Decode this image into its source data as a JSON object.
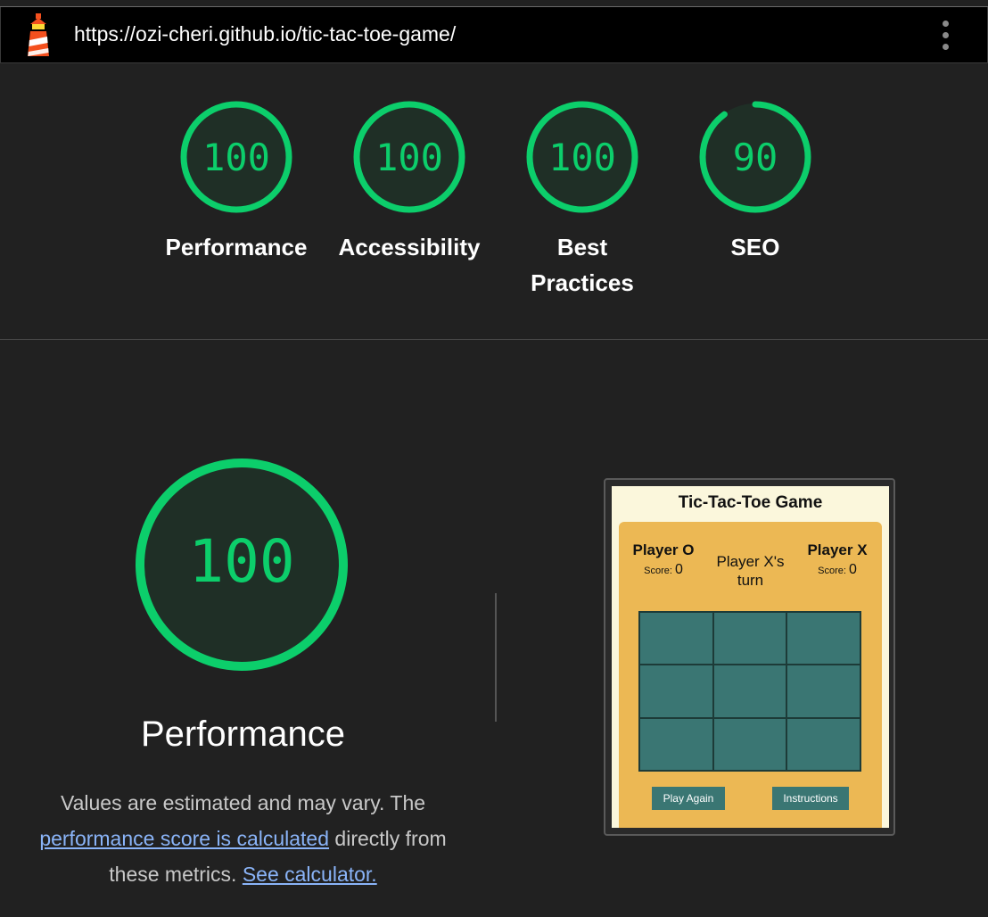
{
  "urlbar": {
    "url": "https://ozi-cheri.github.io/tic-tac-toe-game/"
  },
  "icons": {
    "logo": "lighthouse-icon",
    "menu": "more-vert-icon"
  },
  "colors": {
    "pass": "#0cce6b",
    "gauge_fill": "#1f2f26",
    "link": "#8ab4f8"
  },
  "scores": [
    {
      "value": "100",
      "score": 100,
      "label": "Performance"
    },
    {
      "value": "100",
      "score": 100,
      "label": "Accessibility"
    },
    {
      "value": "100",
      "score": 100,
      "label": "Best Practices"
    },
    {
      "value": "90",
      "score": 90,
      "label": "SEO"
    }
  ],
  "performance": {
    "score": "100",
    "title": "Performance",
    "desc_prefix": "Values are estimated and may vary. The ",
    "desc_link1": "performance score is calculated",
    "desc_middle": " directly from these metrics. ",
    "desc_link2": "See calculator."
  },
  "screenshot": {
    "title": "Tic-Tac-Toe Game",
    "player_o_name": "Player O",
    "player_x_name": "Player X",
    "score_label": "Score:",
    "player_o_score": "0",
    "player_x_score": "0",
    "turn": "Player X's turn",
    "play_again": "Play Again",
    "instructions": "Instructions"
  }
}
